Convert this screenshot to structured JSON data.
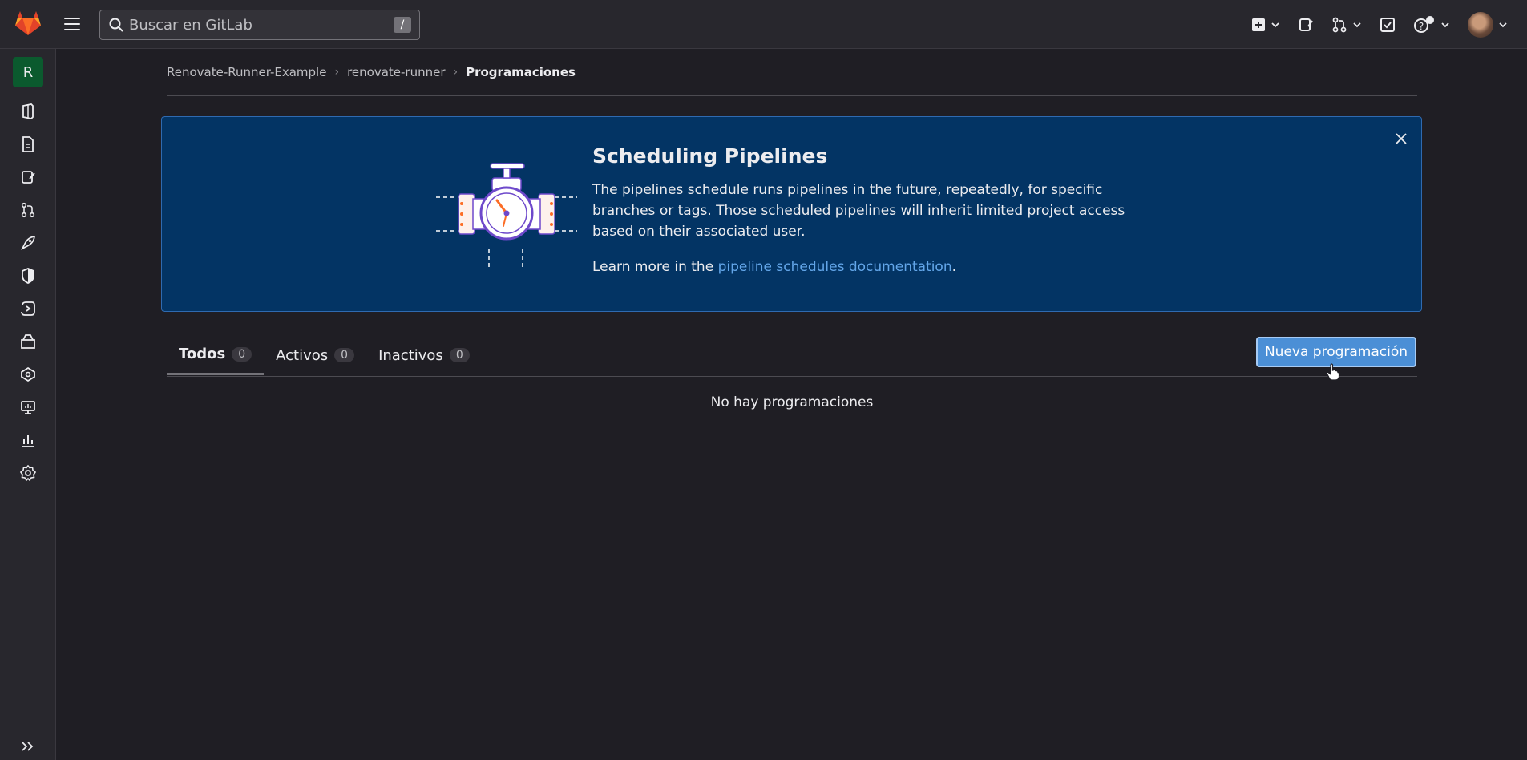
{
  "topbar": {
    "search_placeholder": "Buscar en GitLab",
    "search_shortcut": "/"
  },
  "sidebar": {
    "project_initial": "R",
    "icons": [
      "project-overview-icon",
      "issues-icon",
      "issue-board-icon",
      "merge-requests-icon",
      "deploy-rocket-icon",
      "security-shield-icon",
      "operate-icon",
      "packages-icon",
      "monitor-icon",
      "analytics-icon",
      "chart-icon",
      "settings-gear-icon"
    ]
  },
  "breadcrumb": {
    "group": "Renovate-Runner-Example",
    "project": "renovate-runner",
    "current": "Programaciones"
  },
  "banner": {
    "title": "Scheduling Pipelines",
    "description": "The pipelines schedule runs pipelines in the future, repeatedly, for specific branches or tags. Those scheduled pipelines will inherit limited project access based on their associated user.",
    "learn_prefix": "Learn more in the ",
    "learn_link": "pipeline schedules documentation",
    "learn_suffix": "."
  },
  "tabs": [
    {
      "label": "Todos",
      "count": "0",
      "active": true
    },
    {
      "label": "Activos",
      "count": "0",
      "active": false
    },
    {
      "label": "Inactivos",
      "count": "0",
      "active": false
    }
  ],
  "new_button_label": "Nueva programación",
  "empty_message": "No hay programaciones",
  "colors": {
    "background": "#1f1e24",
    "banner": "#033464",
    "primary_button": "#4b8fd6",
    "link": "#63a6e9"
  }
}
